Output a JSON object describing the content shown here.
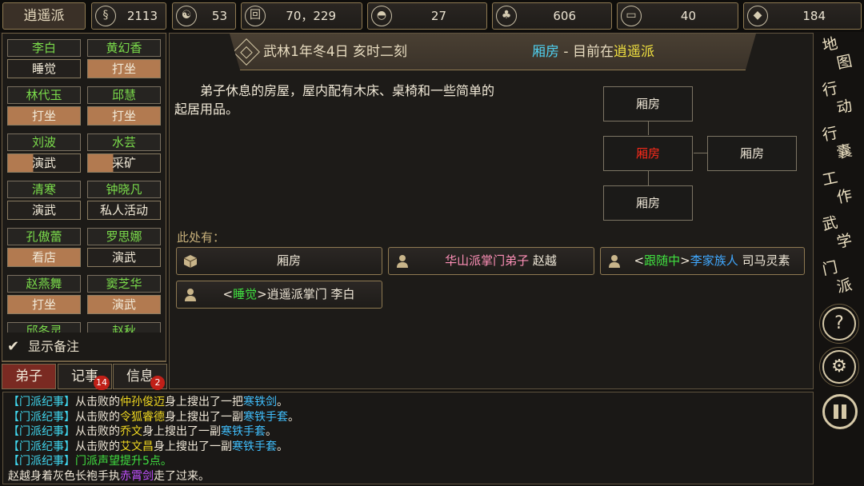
{
  "topbar": {
    "sect": "逍遥派",
    "resources": [
      {
        "icon": "coin-pouch-icon",
        "glyph": "§",
        "value": "2113"
      },
      {
        "icon": "yin-yang-icon",
        "glyph": "☯",
        "value": "53"
      },
      {
        "icon": "copper-coin-icon",
        "glyph": "回",
        "value": "70，229"
      },
      {
        "icon": "food-bowl-icon",
        "glyph": "◓",
        "value": "27"
      },
      {
        "icon": "herb-icon",
        "glyph": "♣",
        "value": "606"
      },
      {
        "icon": "timber-icon",
        "glyph": "▭",
        "value": "40"
      },
      {
        "icon": "ore-icon",
        "glyph": "◆",
        "value": "184"
      }
    ]
  },
  "disciples": [
    {
      "name": "李白",
      "activity": "睡觉",
      "bar": "dark"
    },
    {
      "name": "黄幻香",
      "activity": "打坐",
      "bar": "orange"
    },
    {
      "name": "林代玉",
      "activity": "打坐",
      "bar": "orange"
    },
    {
      "name": "邱慧",
      "activity": "打坐",
      "bar": "orange"
    },
    {
      "name": "刘波",
      "activity": "演武",
      "bar": "half"
    },
    {
      "name": "水芸",
      "activity": "采矿",
      "bar": "half"
    },
    {
      "name": "清寒",
      "activity": "演武",
      "bar": "dark"
    },
    {
      "name": "钟晓凡",
      "activity": "私人活动",
      "bar": "dark"
    },
    {
      "name": "孔傲蕾",
      "activity": "看店",
      "bar": "orange"
    },
    {
      "name": "罗思娜",
      "activity": "演武",
      "bar": "dark"
    },
    {
      "name": "赵燕舞",
      "activity": "打坐",
      "bar": "orange"
    },
    {
      "name": "窦芝华",
      "activity": "演武",
      "bar": "orange"
    },
    {
      "name": "邱冬灵",
      "activity": "",
      "bar": "dark"
    },
    {
      "name": "赵秋",
      "activity": "",
      "bar": "dark"
    }
  ],
  "memo_label": "显示备注",
  "tabs": [
    {
      "label": "弟子",
      "badge": ""
    },
    {
      "label": "记事",
      "badge": "14"
    },
    {
      "label": "信息",
      "badge": "2"
    }
  ],
  "header": {
    "date": "武林1年冬4日 亥时二刻",
    "room": "厢房",
    "sep": " - 目前在",
    "sect": "逍遥派"
  },
  "description": "弟子休息的房屋，屋内配有木床、桌椅和一些简单的起居用品。",
  "map": {
    "north": "厢房",
    "current": "厢房",
    "east": "厢房",
    "south": "厢房"
  },
  "here_label": "此处有：",
  "entities": {
    "object": "厢房",
    "npc1_title": "华山派掌门弟子",
    "npc1_name": " 赵越",
    "npc2_lt": "<",
    "npc2_status": "跟随中",
    "npc2_gt": ">",
    "npc2_title": "李家族人",
    "npc2_name": " 司马灵素",
    "npc3_lt": "<",
    "npc3_status": "睡觉",
    "npc3_gt": ">",
    "npc3_rest": "逍遥派掌门 李白"
  },
  "nav": [
    {
      "c1": "地",
      "c2": "图"
    },
    {
      "c1": "行",
      "c2": "动"
    },
    {
      "c1": "行",
      "c2": "囊"
    },
    {
      "c1": "工",
      "c2": "作"
    },
    {
      "c1": "武",
      "c2": "学"
    },
    {
      "c1": "门",
      "c2": "派"
    }
  ],
  "nav_help": "?",
  "nav_settings": "⚙",
  "log": {
    "tag": "【门派纪事】",
    "l1_a": "从击败的",
    "l1_name": "仲孙俊迈",
    "l1_b": "身上搜出了一把",
    "l1_item": "寒铁剑",
    "l1_end": "。",
    "l2_a": "从击败的",
    "l2_name": "令狐睿德",
    "l2_b": "身上搜出了一副",
    "l2_item": "寒铁手套",
    "l2_end": "。",
    "l3_a": "从击败的",
    "l3_name": "乔文",
    "l3_b": "身上搜出了一副",
    "l3_item": "寒铁手套",
    "l3_end": "。",
    "l4_a": "从击败的",
    "l4_name": "艾文昌",
    "l4_b": "身上搜出了一副",
    "l4_item": "寒铁手套",
    "l4_end": "。",
    "l5_msg": "门派声望提升5点。",
    "l6_a": "赵越身着灰色长袍手执",
    "l6_item": "赤霄剑",
    "l6_b": "走了过来。"
  }
}
